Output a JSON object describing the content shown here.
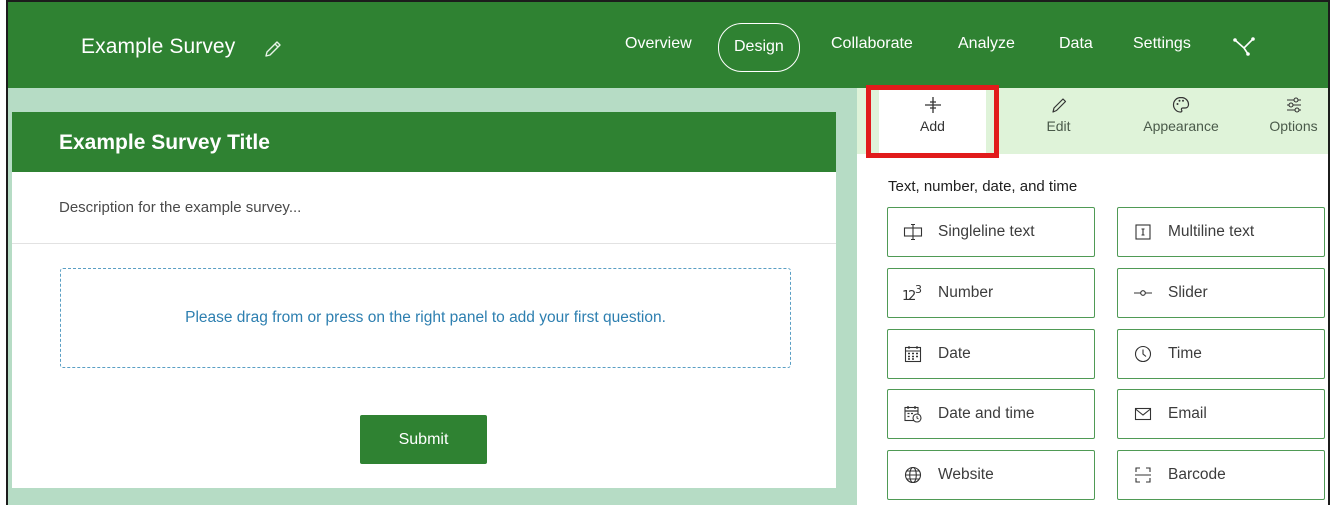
{
  "header": {
    "survey_name": "Example Survey",
    "nav": [
      "Overview",
      "Design",
      "Collaborate",
      "Analyze",
      "Data",
      "Settings"
    ],
    "active_nav": "Design",
    "icons": {
      "edit": "pencil-icon",
      "share": "share-icon"
    }
  },
  "form": {
    "title": "Example Survey Title",
    "description": "Description for the example survey...",
    "dropzone_text": "Please drag from or press on the right panel to add your first question.",
    "submit_label": "Submit"
  },
  "panel": {
    "tabs": [
      {
        "label": "Add",
        "icon": "plus-icon"
      },
      {
        "label": "Edit",
        "icon": "pencil-icon"
      },
      {
        "label": "Appearance",
        "icon": "palette-icon"
      },
      {
        "label": "Options",
        "icon": "sliders-icon"
      }
    ],
    "active_tab": "Add",
    "section_title": "Text, number, date, and time",
    "questions": [
      {
        "label": "Singleline text",
        "icon": "singleline-text-icon"
      },
      {
        "label": "Multiline text",
        "icon": "multiline-text-icon"
      },
      {
        "label": "Number",
        "icon": "number-icon"
      },
      {
        "label": "Slider",
        "icon": "slider-icon"
      },
      {
        "label": "Date",
        "icon": "calendar-icon"
      },
      {
        "label": "Time",
        "icon": "clock-icon"
      },
      {
        "label": "Date and time",
        "icon": "calendar-clock-icon"
      },
      {
        "label": "Email",
        "icon": "envelope-icon"
      },
      {
        "label": "Website",
        "icon": "globe-icon"
      },
      {
        "label": "Barcode",
        "icon": "barcode-icon"
      }
    ]
  },
  "colors": {
    "brand_green": "#2f8232",
    "canvas_bg": "#b6dcc5",
    "tab_bar_bg": "#dff3d9",
    "highlight": "#e11b1b",
    "link_blue": "#2d7fb0"
  }
}
